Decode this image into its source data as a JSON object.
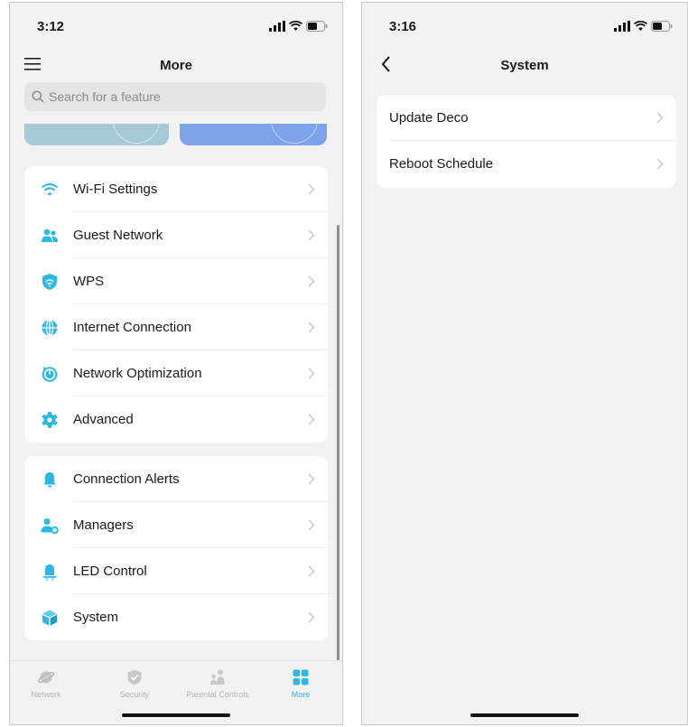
{
  "left_screen": {
    "status_time": "3:12",
    "title": "More",
    "search_placeholder": "Search for a feature",
    "group1": [
      {
        "label": "Wi-Fi Settings",
        "icon": "wifi-icon"
      },
      {
        "label": "Guest Network",
        "icon": "guest-users-icon"
      },
      {
        "label": "WPS",
        "icon": "wps-shield-icon"
      },
      {
        "label": "Internet Connection",
        "icon": "globe-icon"
      },
      {
        "label": "Network Optimization",
        "icon": "optimization-icon"
      },
      {
        "label": "Advanced",
        "icon": "gear-icon"
      }
    ],
    "group2": [
      {
        "label": "Connection Alerts",
        "icon": "bell-icon"
      },
      {
        "label": "Managers",
        "icon": "managers-icon"
      },
      {
        "label": "LED Control",
        "icon": "led-lamp-icon"
      },
      {
        "label": "System",
        "icon": "cube-icon"
      }
    ],
    "tabs": [
      {
        "label": "Network",
        "icon": "planet-icon",
        "active": false
      },
      {
        "label": "Security",
        "icon": "shield-check-icon",
        "active": false
      },
      {
        "label": "Parental Controls",
        "icon": "family-icon",
        "active": false
      },
      {
        "label": "More",
        "icon": "grid-icon",
        "active": true
      }
    ]
  },
  "right_screen": {
    "status_time": "3:16",
    "title": "System",
    "items": [
      {
        "label": "Update Deco"
      },
      {
        "label": "Reboot Schedule"
      }
    ]
  },
  "colors": {
    "accent": "#2ab8e5",
    "background": "#f2f2f4",
    "card": "#ffffff"
  }
}
